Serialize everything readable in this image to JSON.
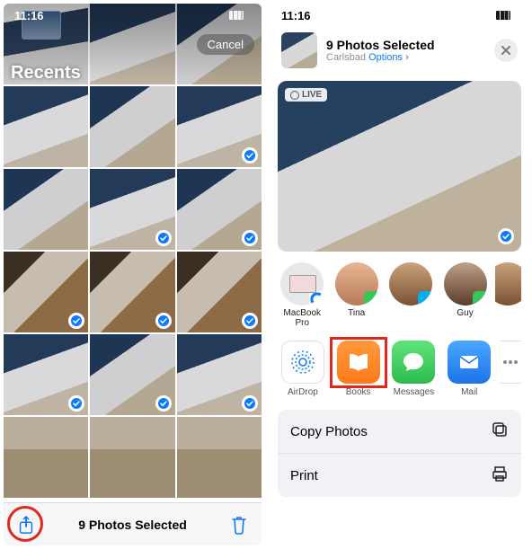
{
  "left": {
    "status_time": "11:16",
    "cancel": "Cancel",
    "album_title": "Recents",
    "selected_label": "9 Photos Selected",
    "rows": [
      [
        {
          "sel": false,
          "cls": "edge"
        },
        {
          "sel": false,
          "cls": "watch1"
        },
        {
          "sel": false,
          "cls": "watch2"
        }
      ],
      [
        {
          "sel": false,
          "cls": "watch1"
        },
        {
          "sel": false,
          "cls": "watch2"
        },
        {
          "sel": true,
          "cls": "watch1"
        }
      ],
      [
        {
          "sel": false,
          "cls": "watch2"
        },
        {
          "sel": true,
          "cls": "watch1"
        },
        {
          "sel": true,
          "cls": "watch2"
        }
      ],
      [
        {
          "sel": true,
          "cls": "wood"
        },
        {
          "sel": true,
          "cls": "wood"
        },
        {
          "sel": true,
          "cls": "wood"
        }
      ],
      [
        {
          "sel": true,
          "cls": "watch1"
        },
        {
          "sel": true,
          "cls": "watch2"
        },
        {
          "sel": true,
          "cls": "watch1"
        }
      ],
      [
        {
          "sel": false,
          "cls": "strap"
        },
        {
          "sel": false,
          "cls": "strap"
        },
        {
          "sel": false,
          "cls": "strap"
        }
      ]
    ]
  },
  "right": {
    "status_time": "11:16",
    "title": "9 Photos Selected",
    "location": "Carlsbad",
    "options_label": "Options",
    "live_label": "LIVE",
    "contacts": [
      {
        "name": "MacBook Pro",
        "cls": "mac",
        "mini": "ad"
      },
      {
        "name": "Tina",
        "cls": "f1",
        "mini": "msg"
      },
      {
        "name": "",
        "cls": "f2",
        "mini": "sk"
      },
      {
        "name": "Guy",
        "cls": "f3",
        "mini": "msg"
      },
      {
        "name": "",
        "cls": "f2",
        "mini": ""
      }
    ],
    "apps": [
      {
        "name": "AirDrop",
        "cls": "airdrop"
      },
      {
        "name": "Books",
        "cls": "books"
      },
      {
        "name": "Messages",
        "cls": "messages"
      },
      {
        "name": "Mail",
        "cls": "mail"
      }
    ],
    "actions": [
      {
        "label": "Copy Photos",
        "icon": "copy"
      },
      {
        "label": "Print",
        "icon": "print"
      }
    ]
  }
}
